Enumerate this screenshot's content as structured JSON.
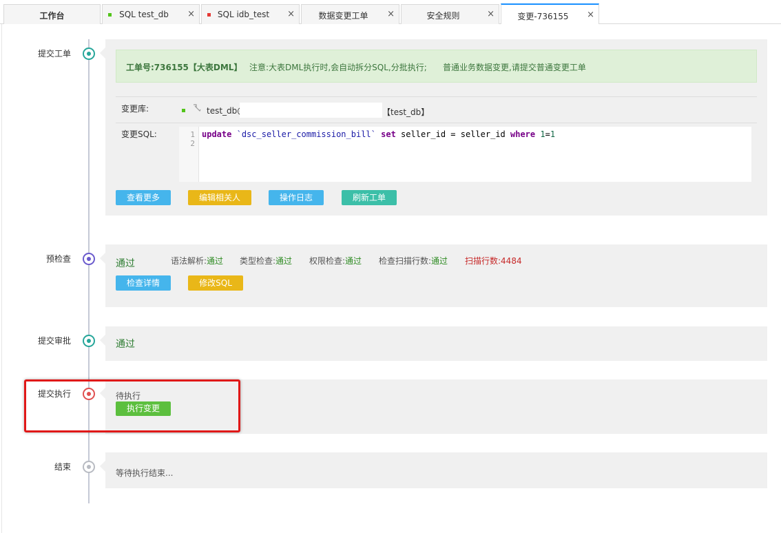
{
  "tabs": [
    {
      "label": "工作台",
      "dot": null
    },
    {
      "label": "SQL test_db",
      "dot": "#52c41a"
    },
    {
      "label": "SQL idb_test",
      "dot": "#e53935"
    },
    {
      "label": "数据变更工单",
      "dot": null
    },
    {
      "label": "安全规则",
      "dot": null
    },
    {
      "label": "变更-736155",
      "dot": null
    }
  ],
  "close_glyph": "×",
  "steps": {
    "submit": {
      "label": "提交工单"
    },
    "precheck": {
      "label": "预检查"
    },
    "approval": {
      "label": "提交审批"
    },
    "execute": {
      "label": "提交执行"
    },
    "end": {
      "label": "结束"
    }
  },
  "ticket": {
    "notice_id": "工单号:736155【大表DML】",
    "notice_note": "注意:大表DML执行时,会自动拆分SQL,分批执行;",
    "notice_tip": "普通业务数据变更,请提交普通变更工单",
    "db_label": "变更库:",
    "db_name": "test_db@",
    "db_suffix": "【test_db】",
    "sql_label": "变更SQL:",
    "line_numbers": [
      "1",
      "2"
    ],
    "sql_tokens": {
      "update": "update",
      "table": "`dsc_seller_commission_bill`",
      "set": "set",
      "mid": "seller_id = seller_id",
      "where": "where",
      "n1": "1",
      "eq": "=",
      "n2": "1"
    },
    "buttons": {
      "view_more": "查看更多",
      "edit_related": "编辑相关人",
      "op_log": "操作日志",
      "refresh": "刷新工单"
    }
  },
  "precheck": {
    "status": "通过",
    "checks": [
      {
        "name": "语法解析:",
        "value": "通过"
      },
      {
        "name": "类型检查:",
        "value": "通过"
      },
      {
        "name": "权限检查:",
        "value": "通过"
      },
      {
        "name": "检查扫描行数:",
        "value": "通过"
      }
    ],
    "scan_rows": "扫描行数:4484",
    "buttons": {
      "detail": "检查详情",
      "modify_sql": "修改SQL"
    }
  },
  "approval": {
    "status": "通过"
  },
  "execute": {
    "status": "待执行",
    "button": "执行变更"
  },
  "end": {
    "status": "等待执行结束..."
  },
  "icons": {
    "db": "plug-icon"
  }
}
